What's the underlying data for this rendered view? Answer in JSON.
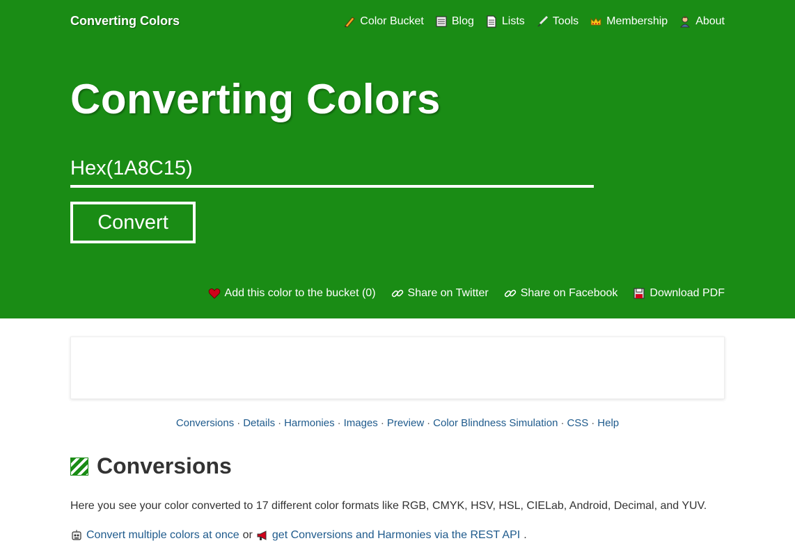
{
  "brand": "Converting Colors",
  "nav": [
    {
      "label": "Color Bucket",
      "icon": "pencil-icon"
    },
    {
      "label": "Blog",
      "icon": "newspaper-icon"
    },
    {
      "label": "Lists",
      "icon": "document-icon"
    },
    {
      "label": "Tools",
      "icon": "brush-icon"
    },
    {
      "label": "Membership",
      "icon": "crown-icon"
    },
    {
      "label": "About",
      "icon": "person-icon"
    }
  ],
  "hero": {
    "title": "Converting Colors",
    "input_value": "Hex(1A8C15)",
    "convert_label": "Convert",
    "background_color": "#1a8c15"
  },
  "actions": [
    {
      "label": "Add this color to the bucket (0)",
      "icon": "heart-icon"
    },
    {
      "label": "Share on Twitter",
      "icon": "link-icon"
    },
    {
      "label": "Share on Facebook",
      "icon": "link-icon"
    },
    {
      "label": "Download PDF",
      "icon": "floppy-disk-icon"
    }
  ],
  "toc": [
    "Conversions",
    "Details",
    "Harmonies",
    "Images",
    "Preview",
    "Color Blindness Simulation",
    "CSS",
    "Help"
  ],
  "section": {
    "title": "Conversions",
    "description": "Here you see your color converted to 17 different color formats like RGB, CMYK, HSV, HSL, CIELab, Android, Decimal, and YUV.",
    "link1": "Convert multiple colors at once",
    "connector": "or",
    "link2": "get Conversions and Harmonies via the REST API",
    "trailing": "."
  }
}
